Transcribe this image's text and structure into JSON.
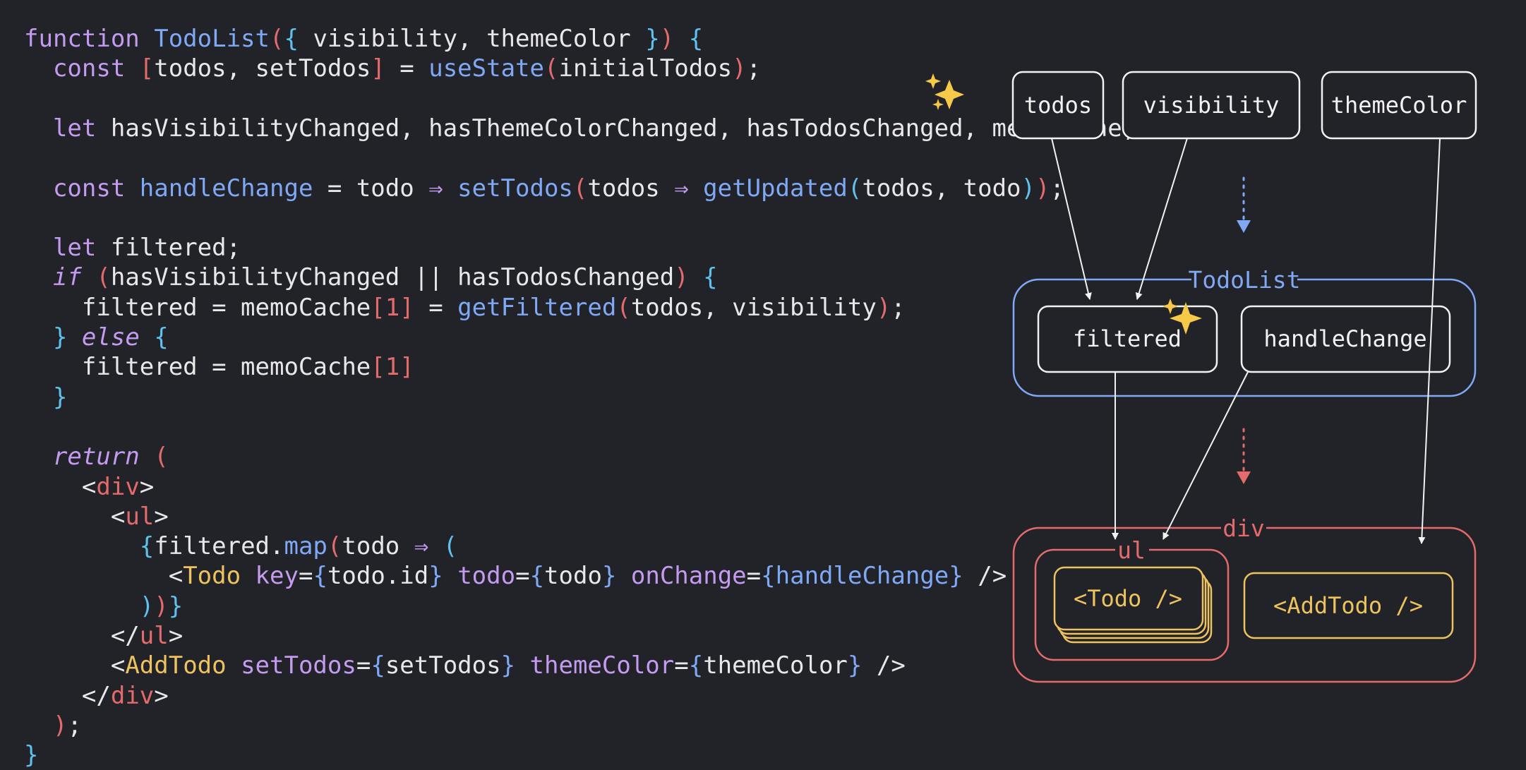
{
  "code": {
    "lines": [
      [
        [
          "function ",
          "tok-key"
        ],
        [
          "TodoList",
          "tok-fn"
        ],
        [
          "(",
          "tok-br"
        ],
        [
          "{ ",
          "tok-br2"
        ],
        [
          "visibility, themeColor ",
          "tok-text"
        ],
        [
          "}",
          "tok-br2"
        ],
        [
          ") ",
          "tok-br"
        ],
        [
          "{",
          "tok-br2"
        ]
      ],
      [
        [
          "  ",
          "tok-text"
        ],
        [
          "const ",
          "tok-key"
        ],
        [
          "[",
          "tok-br"
        ],
        [
          "todos, setTodos",
          "tok-text"
        ],
        [
          "]",
          "tok-br"
        ],
        [
          " = ",
          "tok-text"
        ],
        [
          "useState",
          "tok-fn"
        ],
        [
          "(",
          "tok-br"
        ],
        [
          "initialTodos",
          "tok-text"
        ],
        [
          ")",
          "tok-br"
        ],
        [
          ";",
          "tok-text"
        ]
      ],
      [],
      [
        [
          "  ",
          "tok-text"
        ],
        [
          "let ",
          "tok-key"
        ],
        [
          "hasVisibilityChanged, hasThemeColorChanged, hasTodosChanged, memoCache;",
          "tok-text"
        ]
      ],
      [],
      [
        [
          "  ",
          "tok-text"
        ],
        [
          "const ",
          "tok-key"
        ],
        [
          "handleChange",
          "tok-fn"
        ],
        [
          " = todo ",
          "tok-text"
        ],
        [
          "⇒ ",
          "tok-key"
        ],
        [
          "setTodos",
          "tok-fn"
        ],
        [
          "(",
          "tok-br"
        ],
        [
          "todos ",
          "tok-text"
        ],
        [
          "⇒ ",
          "tok-key"
        ],
        [
          "getUpdated",
          "tok-fn"
        ],
        [
          "(",
          "tok-br2"
        ],
        [
          "todos, todo",
          "tok-text"
        ],
        [
          ")",
          "tok-br2"
        ],
        [
          ")",
          "tok-br"
        ],
        [
          ";",
          "tok-text"
        ]
      ],
      [],
      [
        [
          "  ",
          "tok-text"
        ],
        [
          "let ",
          "tok-key"
        ],
        [
          "filtered;",
          "tok-text"
        ]
      ],
      [
        [
          "  ",
          "tok-text"
        ],
        [
          "if ",
          "tok-keyi"
        ],
        [
          "(",
          "tok-br"
        ],
        [
          "hasVisibilityChanged || hasTodosChanged",
          "tok-text"
        ],
        [
          ") ",
          "tok-br"
        ],
        [
          "{",
          "tok-br2"
        ]
      ],
      [
        [
          "    filtered = memoCache",
          "tok-text"
        ],
        [
          "[",
          "tok-br"
        ],
        [
          "1",
          "tok-num"
        ],
        [
          "]",
          "tok-br"
        ],
        [
          " = ",
          "tok-text"
        ],
        [
          "getFiltered",
          "tok-fn"
        ],
        [
          "(",
          "tok-br"
        ],
        [
          "todos, visibility",
          "tok-text"
        ],
        [
          ")",
          "tok-br"
        ],
        [
          ";",
          "tok-text"
        ]
      ],
      [
        [
          "  ",
          "tok-text"
        ],
        [
          "} ",
          "tok-br2"
        ],
        [
          "else ",
          "tok-keyi"
        ],
        [
          "{",
          "tok-br2"
        ]
      ],
      [
        [
          "    filtered = memoCache",
          "tok-text"
        ],
        [
          "[",
          "tok-br"
        ],
        [
          "1",
          "tok-num"
        ],
        [
          "]",
          "tok-br"
        ]
      ],
      [
        [
          "  ",
          "tok-text"
        ],
        [
          "}",
          "tok-br2"
        ]
      ],
      [],
      [
        [
          "  ",
          "tok-text"
        ],
        [
          "return ",
          "tok-keyi"
        ],
        [
          "(",
          "tok-br"
        ]
      ],
      [
        [
          "    ",
          "tok-text"
        ],
        [
          "<",
          "tok-text"
        ],
        [
          "div",
          "tok-tag"
        ],
        [
          ">",
          "tok-text"
        ]
      ],
      [
        [
          "      ",
          "tok-text"
        ],
        [
          "<",
          "tok-text"
        ],
        [
          "ul",
          "tok-tag"
        ],
        [
          ">",
          "tok-text"
        ]
      ],
      [
        [
          "        ",
          "tok-text"
        ],
        [
          "{",
          "tok-br2"
        ],
        [
          "filtered.",
          "tok-text"
        ],
        [
          "map",
          "tok-fn"
        ],
        [
          "(",
          "tok-br"
        ],
        [
          "todo ",
          "tok-text"
        ],
        [
          "⇒ ",
          "tok-key"
        ],
        [
          "(",
          "tok-br2"
        ]
      ],
      [
        [
          "          ",
          "tok-text"
        ],
        [
          "<",
          "tok-text"
        ],
        [
          "Todo ",
          "tok-comp"
        ],
        [
          "key",
          "tok-attr"
        ],
        [
          "=",
          "tok-text"
        ],
        [
          "{",
          "tok-bra"
        ],
        [
          "todo.id",
          "tok-text"
        ],
        [
          "} ",
          "tok-bra"
        ],
        [
          "todo",
          "tok-attr"
        ],
        [
          "=",
          "tok-text"
        ],
        [
          "{",
          "tok-bra"
        ],
        [
          "todo",
          "tok-text"
        ],
        [
          "} ",
          "tok-bra"
        ],
        [
          "onChange",
          "tok-attr"
        ],
        [
          "=",
          "tok-text"
        ],
        [
          "{",
          "tok-bra"
        ],
        [
          "handleChange",
          "tok-fn"
        ],
        [
          "}",
          "tok-bra"
        ],
        [
          " />",
          "tok-text"
        ]
      ],
      [
        [
          "        ",
          "tok-text"
        ],
        [
          ")",
          "tok-br2"
        ],
        [
          ")",
          "tok-br"
        ],
        [
          "}",
          "tok-br2"
        ]
      ],
      [
        [
          "      ",
          "tok-text"
        ],
        [
          "</",
          "tok-text"
        ],
        [
          "ul",
          "tok-tag"
        ],
        [
          ">",
          "tok-text"
        ]
      ],
      [
        [
          "      ",
          "tok-text"
        ],
        [
          "<",
          "tok-text"
        ],
        [
          "AddTodo ",
          "tok-comp"
        ],
        [
          "setTodos",
          "tok-attr"
        ],
        [
          "=",
          "tok-text"
        ],
        [
          "{",
          "tok-bra"
        ],
        [
          "setTodos",
          "tok-text"
        ],
        [
          "} ",
          "tok-bra"
        ],
        [
          "themeColor",
          "tok-attr"
        ],
        [
          "=",
          "tok-text"
        ],
        [
          "{",
          "tok-bra"
        ],
        [
          "themeColor",
          "tok-text"
        ],
        [
          "}",
          "tok-bra"
        ],
        [
          " />",
          "tok-text"
        ]
      ],
      [
        [
          "    ",
          "tok-text"
        ],
        [
          "</",
          "tok-text"
        ],
        [
          "div",
          "tok-tag"
        ],
        [
          ">",
          "tok-text"
        ]
      ],
      [
        [
          "  ",
          "tok-text"
        ],
        [
          ")",
          "tok-br"
        ],
        [
          ";",
          "tok-text"
        ]
      ],
      [
        [
          "}",
          "tok-br2"
        ]
      ]
    ]
  },
  "diagram": {
    "inputs": {
      "todos": "todos",
      "visibility": "visibility",
      "themeColor": "themeColor"
    },
    "todolist": {
      "label": "TodoList",
      "filtered": "filtered",
      "handleChange": "handleChange"
    },
    "div": {
      "label": "div",
      "ul": "ul",
      "todo": "<Todo />",
      "addtodo": "<AddTodo />"
    },
    "colors": {
      "background": "#212329",
      "node_border": "#f2f2f2",
      "todolist_group": "#7fa8f5",
      "div_group": "#e36b6b",
      "component": "#eec35e",
      "sparkle": "#f7c948"
    },
    "icons": [
      "sparkle-icon",
      "dotted-arrow-down-icon"
    ]
  }
}
